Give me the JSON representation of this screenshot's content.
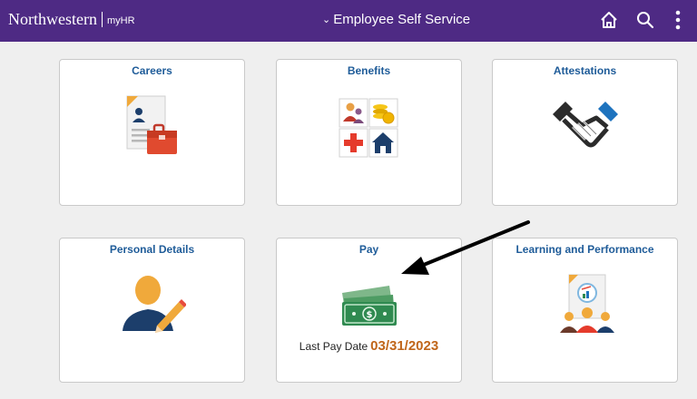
{
  "header": {
    "brand": "Northwestern",
    "brand_sub": "myHR",
    "nav_title": "Employee Self Service",
    "colors": {
      "bar": "#4e2a84",
      "text": "#ffffff"
    },
    "icons": [
      "home-icon",
      "search-icon",
      "more-vertical-icon"
    ]
  },
  "tiles": {
    "careers": {
      "title": "Careers",
      "icon": "resume-briefcase-icon"
    },
    "benefits": {
      "title": "Benefits",
      "icon": "benefits-grid-icon"
    },
    "attestations": {
      "title": "Attestations",
      "icon": "handshake-icon"
    },
    "personal_details": {
      "title": "Personal Details",
      "icon": "person-pencil-icon"
    },
    "pay": {
      "title": "Pay",
      "icon": "money-bills-icon",
      "last_pay_label": "Last Pay Date",
      "last_pay_value": "03/31/2023"
    },
    "learning": {
      "title": "Learning and Performance",
      "icon": "report-people-icon"
    }
  },
  "accent_colors": {
    "tile_title": "#1f5c99",
    "pay_date": "#c0661a"
  },
  "annotation": {
    "icon": "arrow-pointer"
  }
}
